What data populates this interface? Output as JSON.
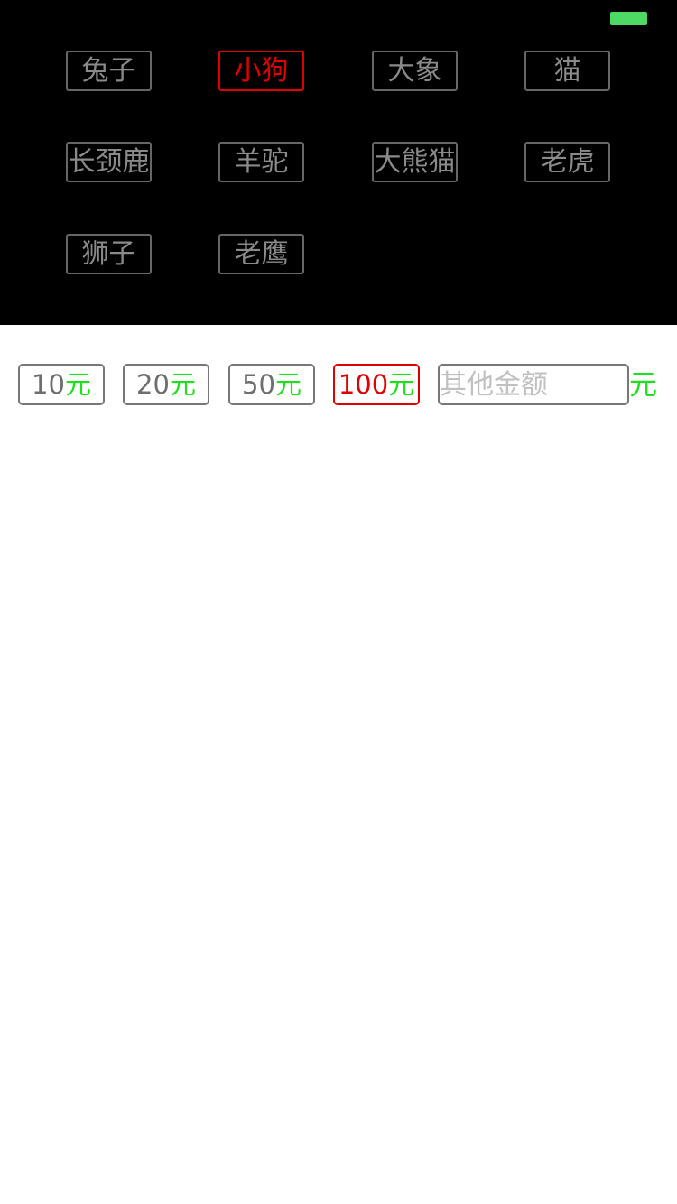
{
  "colors": {
    "panel_background": "#000000",
    "battery": "#4cd964",
    "button_border": "#666666",
    "button_text": "#8a8a8a",
    "selected": "#e00000",
    "unit_green": "#1ee01e",
    "placeholder": "#c0c0c0"
  },
  "animals": {
    "selected_index": 1,
    "items": [
      {
        "label": "兔子"
      },
      {
        "label": "小狗"
      },
      {
        "label": "大象"
      },
      {
        "label": "猫"
      },
      {
        "label": "长颈鹿"
      },
      {
        "label": "羊驼"
      },
      {
        "label": "大熊猫"
      },
      {
        "label": "老虎"
      },
      {
        "label": "狮子"
      },
      {
        "label": "老鹰"
      }
    ]
  },
  "amounts": {
    "selected_index": 3,
    "items": [
      {
        "value": "10",
        "unit": "元"
      },
      {
        "value": "20",
        "unit": "元"
      },
      {
        "value": "50",
        "unit": "元"
      },
      {
        "value": "100",
        "unit": "元"
      }
    ],
    "other": {
      "placeholder": "其他金额",
      "value": "",
      "unit": "元"
    }
  }
}
